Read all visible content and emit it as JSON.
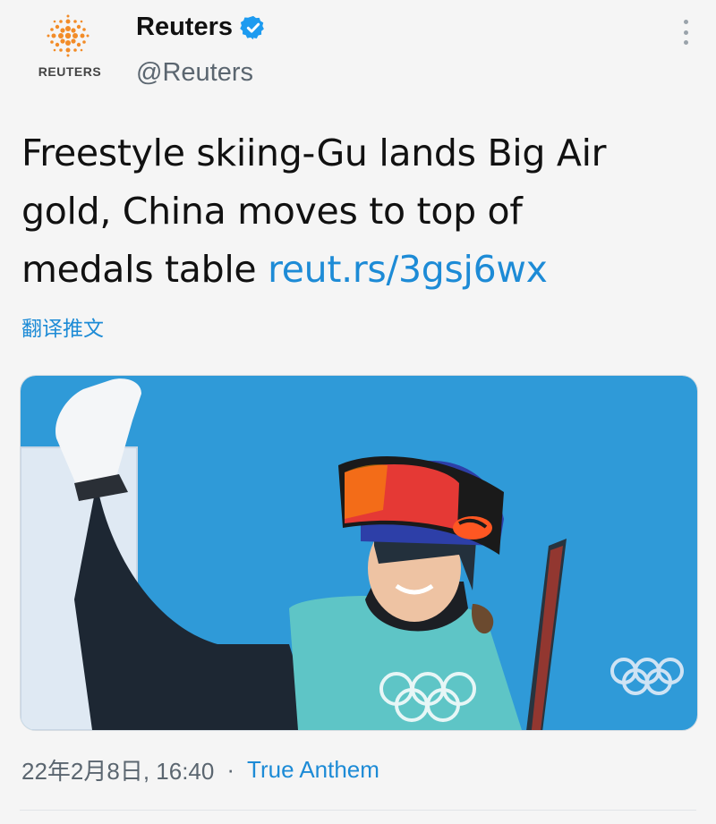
{
  "account": {
    "name": "Reuters",
    "handle": "@Reuters",
    "logo_text": "REUTERS",
    "verified": true
  },
  "tweet": {
    "text": "Freestyle skiing-Gu lands Big Air gold, China moves to top of medals table ",
    "link": "reut.rs/3gsj6wx",
    "translate_label": "翻译推文"
  },
  "meta": {
    "timestamp": "22年2月8日, 16:40",
    "separator": "·",
    "source": "True Anthem"
  },
  "icons": {
    "more": "more-vertical-icon",
    "verified": "verified-badge-icon"
  },
  "colors": {
    "link": "#1d8bd6",
    "verified": "#1d9bf0",
    "logo": "#f28c28",
    "photo_background": "#2f9ad8"
  }
}
